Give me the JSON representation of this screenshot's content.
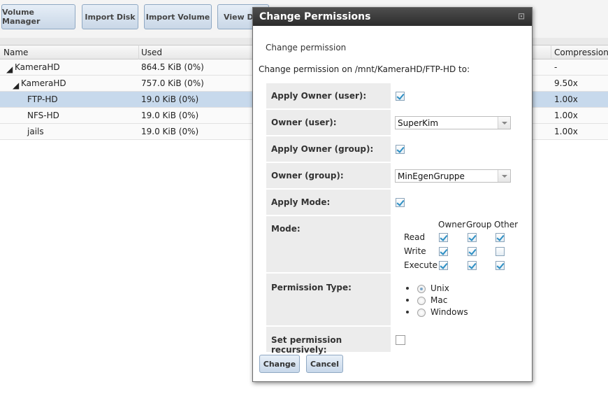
{
  "toolbar": {
    "buttons": [
      "Volume Manager",
      "Import Disk",
      "Import Volume",
      "View Di"
    ]
  },
  "grid": {
    "columns": [
      "Name",
      "Used",
      "Compression"
    ],
    "rows": [
      {
        "name": "KameraHD",
        "used": "864.5 KiB (0%)",
        "compression": "-"
      },
      {
        "name": "KameraHD",
        "used": "757.0 KiB (0%)",
        "compression": "9.50x"
      },
      {
        "name": "FTP-HD",
        "used": "19.0 KiB (0%)",
        "compression": "1.00x",
        "selected": true
      },
      {
        "name": "NFS-HD",
        "used": "19.0 KiB (0%)",
        "compression": "1.00x"
      },
      {
        "name": "jails",
        "used": "19.0 KiB (0%)",
        "compression": "1.00x"
      }
    ]
  },
  "dialog": {
    "title": "Change Permissions",
    "close_icon": "close-icon",
    "subtitle": "Change permission",
    "path_text": "Change permission on /mnt/KameraHD/FTP-HD to:",
    "apply_owner_user_label": "Apply Owner (user):",
    "apply_owner_user": true,
    "owner_user_label": "Owner (user):",
    "owner_user_value": "SuperKim",
    "apply_owner_group_label": "Apply Owner (group):",
    "apply_owner_group": true,
    "owner_group_label": "Owner (group):",
    "owner_group_value": "MinEgenGruppe",
    "apply_mode_label": "Apply Mode:",
    "apply_mode": true,
    "mode_label": "Mode:",
    "mode_columns": [
      "Owner",
      "Group",
      "Other"
    ],
    "mode_rows": [
      {
        "label": "Read",
        "values": [
          true,
          true,
          true
        ]
      },
      {
        "label": "Write",
        "values": [
          true,
          true,
          false
        ]
      },
      {
        "label": "Execute",
        "values": [
          true,
          true,
          true
        ]
      }
    ],
    "permission_type_label": "Permission Type:",
    "permission_types": [
      "Unix",
      "Mac",
      "Windows"
    ],
    "permission_type_selected": "Unix",
    "recursive_label": "Set permission recursively:",
    "recursive": false,
    "change_button": "Change",
    "cancel_button": "Cancel"
  }
}
